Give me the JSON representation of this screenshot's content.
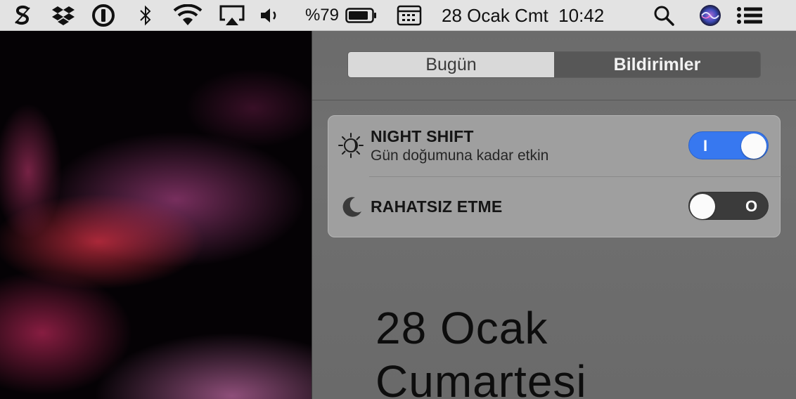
{
  "menubar": {
    "battery_percent": "%79",
    "datetime": "28 Ocak Cmt  10:42",
    "icons": [
      "scrivener-icon",
      "dropbox-icon",
      "1password-icon",
      "bluetooth-icon",
      "wifi-icon",
      "airplay-icon",
      "volume-icon",
      "battery-icon",
      "calendar-app-icon",
      "spotlight-search-icon",
      "siri-icon",
      "notification-center-icon"
    ]
  },
  "notification_center": {
    "tabs": [
      {
        "label": "Bugün",
        "active": true
      },
      {
        "label": "Bildirimler",
        "active": false
      }
    ],
    "night_shift": {
      "title": "NIGHT SHIFT",
      "subtitle": "Gün doğumuna kadar etkin",
      "toggle_on": true,
      "toggle_glyph": "I"
    },
    "do_not_disturb": {
      "title": "RAHATSIZ ETME",
      "toggle_on": false,
      "toggle_glyph": "O"
    },
    "date_line1": "28 Ocak",
    "date_line2": "Cumartesi"
  },
  "colors": {
    "toggle_on": "#3778f0",
    "toggle_off": "#3b3b3b",
    "menubar": "#e3e3e3",
    "panel": "#6b6b6b"
  }
}
